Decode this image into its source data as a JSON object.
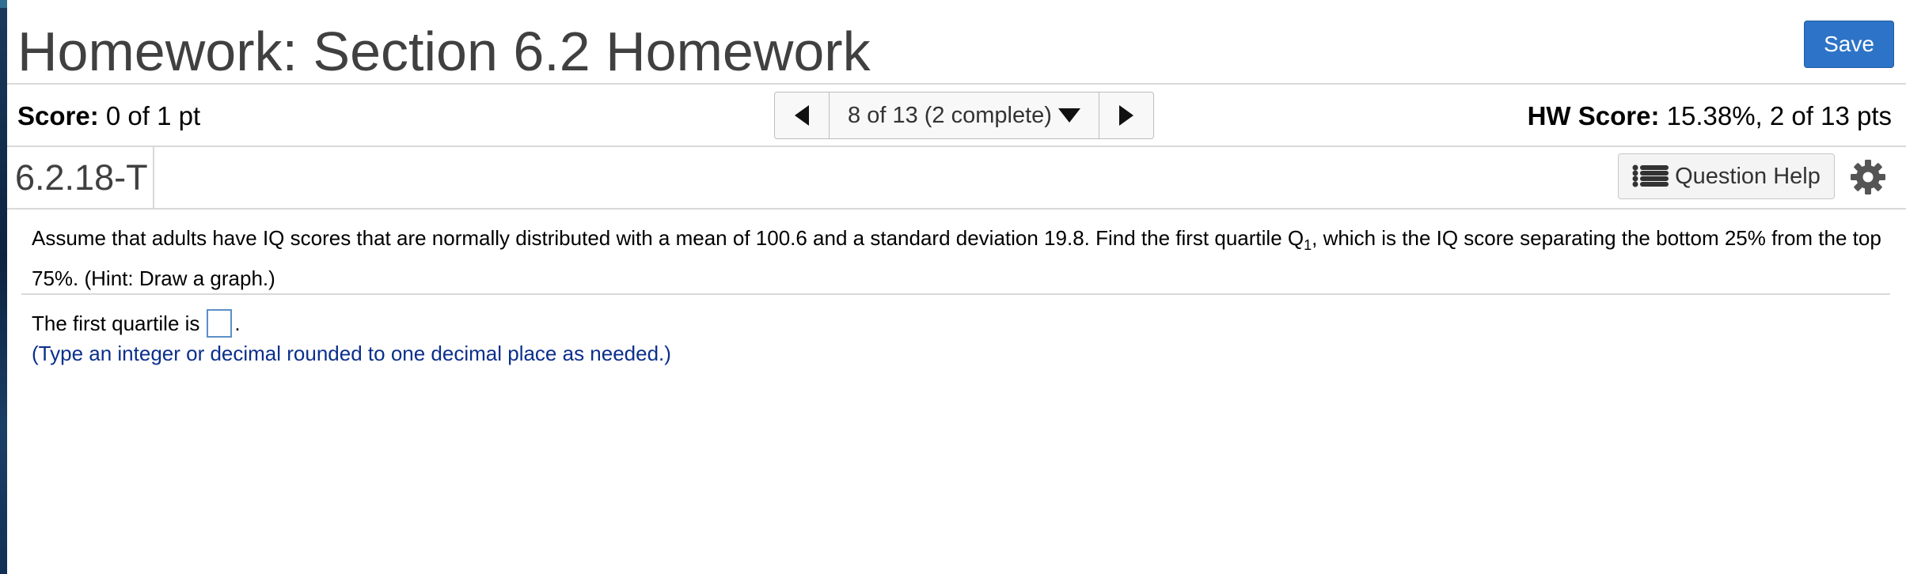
{
  "header": {
    "title": "Homework: Section 6.2 Homework",
    "save_label": "Save"
  },
  "score_bar": {
    "score_label": "Score:",
    "score_value": "0 of 1 pt",
    "nav_label": "8 of 13 (2 complete)",
    "hw_score_label": "HW Score:",
    "hw_score_value": "15.38%, 2 of 13 pts"
  },
  "question": {
    "id": "6.2.18-T",
    "help_label": "Question Help",
    "prompt_part1": "Assume that adults have IQ scores that are normally distributed with a mean of 100.6 and a standard deviation 19.8. Find the first quartile Q",
    "prompt_subscript": "1",
    "prompt_part2": ", which is the IQ score separating the bottom 25% from the top 75%. (Hint: Draw a graph.)",
    "answer_prefix": "The first quartile is",
    "answer_value": "",
    "answer_suffix": ".",
    "hint": "(Type an integer or decimal rounded to one decimal place as needed.)"
  },
  "icons": {
    "prev": "triangle-left-icon",
    "next": "triangle-right-icon",
    "dropdown": "triangle-down-icon",
    "help": "list-icon",
    "settings": "gear-icon"
  },
  "colors": {
    "save_button": "#2d74c8",
    "top_strip": "#2f6f91",
    "hint_text": "#0b2f8c",
    "answer_border": "#5b8fc7"
  }
}
